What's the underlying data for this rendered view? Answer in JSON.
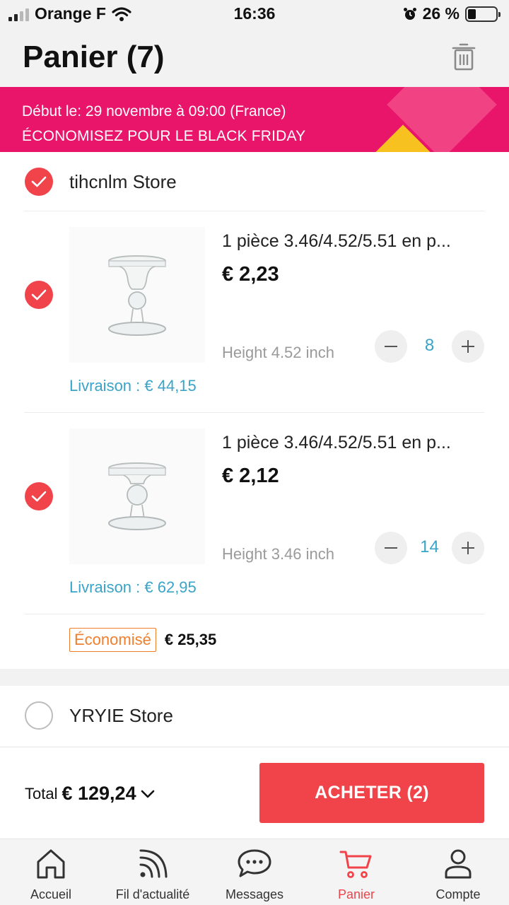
{
  "status_bar": {
    "carrier": "Orange F",
    "time": "16:36",
    "battery_percent": "26 %"
  },
  "header": {
    "title": "Panier (7)",
    "trash_icon": "trash-icon"
  },
  "promo": {
    "line1": "Début le: 29 novembre à 09:00 (France)",
    "line2": "ÉCONOMISEZ POUR LE BLACK FRIDAY",
    "colors": {
      "background": "#e8156b",
      "accent": "#f7c21f"
    }
  },
  "stores": [
    {
      "name": "tihcnlm Store",
      "checked": true,
      "items": [
        {
          "title": "1 pièce 3.46/4.52/5.51 en p...",
          "price": "€ 2,23",
          "variant": "Height 4.52 inch",
          "quantity": "8",
          "shipping": "Livraison : € 44,15",
          "checked": true
        },
        {
          "title": "1 pièce 3.46/4.52/5.51 en p...",
          "price": "€ 2,12",
          "variant": "Height 3.46 inch",
          "quantity": "14",
          "shipping": "Livraison : € 62,95",
          "checked": true
        }
      ],
      "saved_label": "Économisé",
      "saved_amount": "€ 25,35"
    },
    {
      "name": "YRYIE Store",
      "checked": false
    }
  ],
  "checkout": {
    "total_label": "Total",
    "total_amount": "€ 129,24",
    "buy_label": "ACHETER (2)"
  },
  "tabbar": {
    "tabs": [
      {
        "label": "Accueil",
        "icon": "home-icon"
      },
      {
        "label": "Fil d'actualité",
        "icon": "feed-icon"
      },
      {
        "label": "Messages",
        "icon": "messages-icon"
      },
      {
        "label": "Panier",
        "icon": "cart-icon",
        "active": true
      },
      {
        "label": "Compte",
        "icon": "account-icon"
      }
    ]
  },
  "colors": {
    "accent": "#f0444a",
    "link": "#3aa4c8",
    "saved": "#ef7f2d"
  }
}
